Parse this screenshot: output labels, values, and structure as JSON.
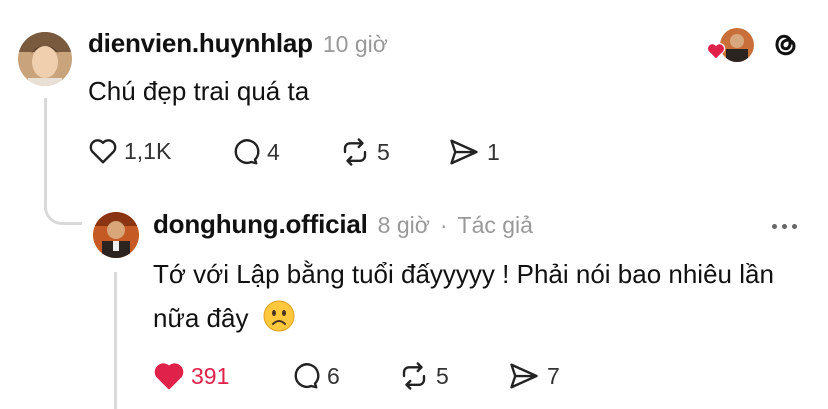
{
  "comment": {
    "username": "dienvien.huynhlap",
    "time": "10 giờ",
    "text": "Chú đẹp trai quá ta",
    "actions": {
      "like_count": "1,1K",
      "reply_count": "4",
      "repost_count": "5",
      "share_count": "1"
    }
  },
  "reply": {
    "username": "donghung.official",
    "time": "8 giờ",
    "separator": "·",
    "author_badge": "Tác giả",
    "text": "Tớ với Lập bằng tuổi đấyyyyy ! Phải nói bao nhiêu lần nữa đây",
    "emoji": "☹",
    "actions": {
      "like_count": "391",
      "liked": true,
      "reply_count": "6",
      "repost_count": "5",
      "share_count": "7"
    }
  },
  "icons": {
    "heart": "heart-icon",
    "comment": "comment-icon",
    "repost": "repost-icon",
    "share": "share-icon",
    "threads": "threads-logo-icon",
    "more": "more-icon"
  },
  "colors": {
    "like_red": "#e0224b",
    "muted": "#999999",
    "text": "#111111"
  }
}
